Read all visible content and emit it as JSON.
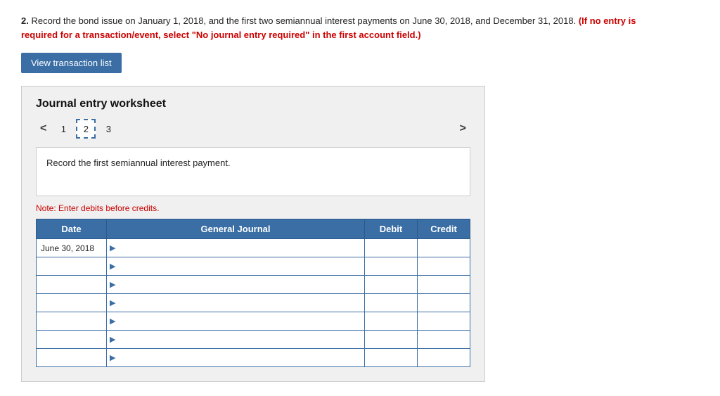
{
  "instruction": {
    "prefix": "2.",
    "main_text": " Record the bond issue on January 1, 2018, and the first two semiannual interest payments on June 30, 2018, and December 31, 2018.",
    "red_text": " (If no entry is required for a transaction/event, select \"No journal entry required\" in the first account field.)"
  },
  "button": {
    "view_transaction": "View transaction list"
  },
  "worksheet": {
    "title": "Journal entry worksheet",
    "tabs": [
      {
        "label": "1",
        "active": false
      },
      {
        "label": "2",
        "active": true
      },
      {
        "label": "3",
        "active": false
      }
    ],
    "nav_left": "<",
    "nav_right": ">",
    "description": "Record the first semiannual interest payment.",
    "note": "Note: Enter debits before credits.",
    "table": {
      "headers": {
        "date": "Date",
        "general_journal": "General Journal",
        "debit": "Debit",
        "credit": "Credit"
      },
      "rows": [
        {
          "date": "June 30, 2018",
          "gj": "",
          "debit": "",
          "credit": ""
        },
        {
          "date": "",
          "gj": "",
          "debit": "",
          "credit": ""
        },
        {
          "date": "",
          "gj": "",
          "debit": "",
          "credit": ""
        },
        {
          "date": "",
          "gj": "",
          "debit": "",
          "credit": ""
        },
        {
          "date": "",
          "gj": "",
          "debit": "",
          "credit": ""
        },
        {
          "date": "",
          "gj": "",
          "debit": "",
          "credit": ""
        },
        {
          "date": "",
          "gj": "",
          "debit": "",
          "credit": ""
        }
      ]
    }
  }
}
